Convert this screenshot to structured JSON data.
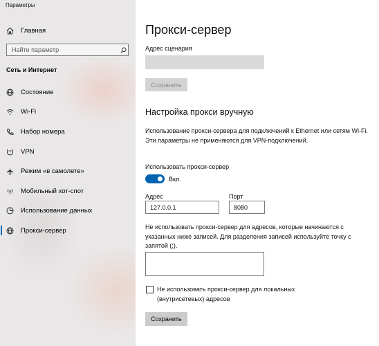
{
  "window": {
    "title": "Параметры"
  },
  "sidebar": {
    "home_label": "Главная",
    "search_placeholder": "Найти параметр",
    "section_title": "Сеть и Интернет",
    "items": [
      {
        "label": "Состояние",
        "icon": "globe-icon"
      },
      {
        "label": "Wi-Fi",
        "icon": "wifi-icon"
      },
      {
        "label": "Набор номера",
        "icon": "phone-icon"
      },
      {
        "label": "VPN",
        "icon": "vpn-icon"
      },
      {
        "label": "Режим «в самолете»",
        "icon": "airplane-icon"
      },
      {
        "label": "Мобильный хот-спот",
        "icon": "hotspot-icon"
      },
      {
        "label": "Использование данных",
        "icon": "data-usage-icon"
      },
      {
        "label": "Прокси-сервер",
        "icon": "proxy-globe-icon",
        "active": true
      }
    ]
  },
  "main": {
    "title": "Прокси-сервер",
    "script_address_label": "Адрес сценария",
    "script_address_value": "",
    "save_script_label": "Сохранить",
    "manual_heading": "Настройка прокси вручную",
    "manual_description": "Использование прокси-сервера для подключений к Ethernet или сетям Wi-Fi. Эти параметры не применяются для VPN-подключений.",
    "use_proxy_label": "Использовать прокси-сервер",
    "toggle_state_label": "Вкл.",
    "toggle_on": true,
    "address_label": "Адрес",
    "address_value": "127.0.0.1",
    "port_label": "Порт",
    "port_value": "8080",
    "exceptions_description": "Не использовать прокси-сервер для адресов, которые начинаются с указанных ниже записей. Для разделения записей используйте точку с запятой (;).",
    "exceptions_value": "",
    "local_bypass_label": "Не использовать прокси-сервер для локальных (внутрисетевых) адресов",
    "local_bypass_checked": false,
    "save_label": "Сохранить"
  },
  "colors": {
    "accent": "#0063b1",
    "sidebar_bg": "#e9e7e7",
    "button_bg": "#cccccc"
  }
}
